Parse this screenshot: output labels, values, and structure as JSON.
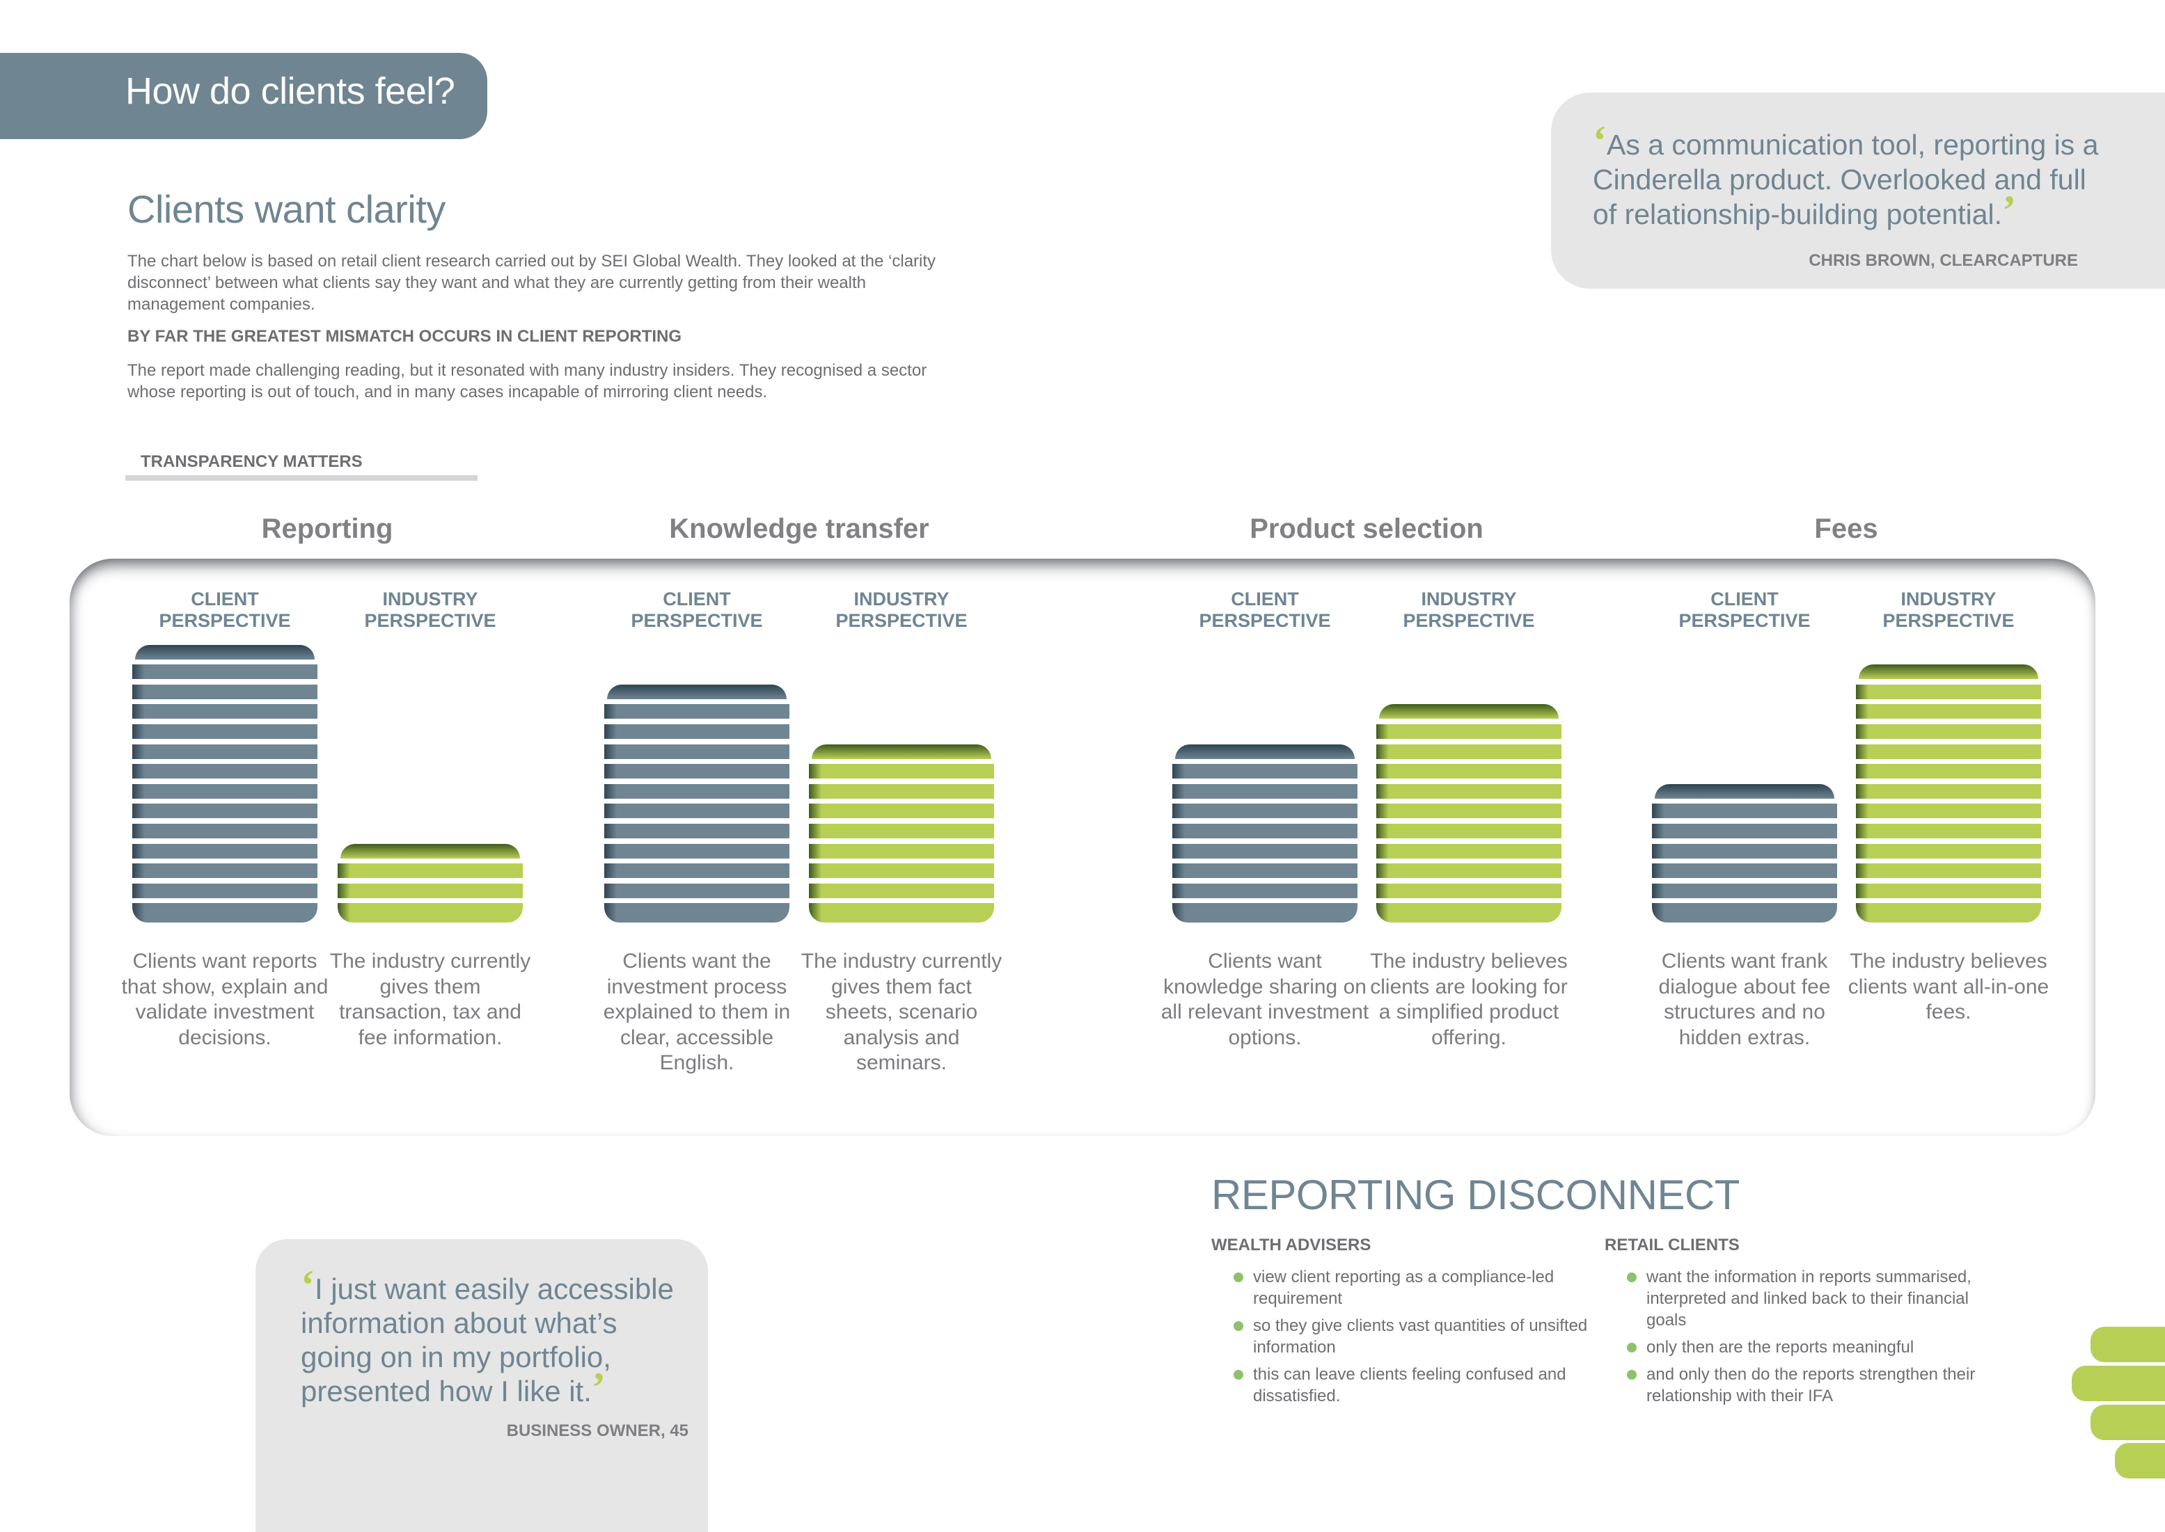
{
  "header": {
    "title": "How do clients feel?"
  },
  "intro": {
    "title": "Clients want clarity",
    "paragraph1": "The chart below is based on retail client research carried out by SEI Global Wealth. They looked at the ‘clarity disconnect’ between what clients say they want and what they are currently getting from their wealth management companies.",
    "heading": "BY FAR THE GREATEST MISMATCH OCCURS IN CLIENT REPORTING",
    "paragraph2": "The report made challenging reading, but it resonated with many industry insiders. They recognised a sector whose reporting is out of touch, and in many cases incapable of mirroring client needs."
  },
  "quote_top": {
    "open_mark": "‘",
    "text": "As a communication tool, reporting is a Cinderella product. Overlooked and full of relationship-building potential.",
    "close_mark": "’",
    "attribution": "CHRIS BROWN, CLEARCAPTURE"
  },
  "quote_bottom": {
    "open_mark": "‘",
    "text": "I just want easily accessible information about what’s going on in my portfolio, presented how I like it.",
    "close_mark": "’",
    "attribution": "BUSINESS OWNER, 45"
  },
  "transparency_label": "TRANSPARENCY MATTERS",
  "colors": {
    "slate": "#6f8592",
    "slate_dark": "#2f4452",
    "green": "#b7cf54",
    "green_dark": "#3f5a1e",
    "quote_bg": "#e6e6e7",
    "bullet": "#8dc26a"
  },
  "chart_data": {
    "type": "bar",
    "title": "TRANSPARENCY MATTERS",
    "unit": "stacked stripes (relative emphasis)",
    "categories": [
      "Reporting",
      "Knowledge transfer",
      "Product selection",
      "Fees"
    ],
    "series": [
      {
        "name": "CLIENT PERSPECTIVE",
        "label_line1": "CLIENT",
        "label_line2": "PERSPECTIVE",
        "color": "#6f8592",
        "values": [
          14,
          12,
          9,
          7
        ]
      },
      {
        "name": "INDUSTRY PERSPECTIVE",
        "label_line1": "INDUSTRY",
        "label_line2": "PERSPECTIVE",
        "color": "#b7cf54",
        "values": [
          4,
          9,
          11,
          13
        ]
      }
    ],
    "captions": [
      [
        "Clients want reports that show, explain and validate investment decisions.",
        "The industry currently gives them transaction, tax and fee information."
      ],
      [
        "Clients want the investment process explained to them in clear, accessible English.",
        "The industry currently gives them fact sheets, scenario analysis and seminars."
      ],
      [
        "Clients want knowledge sharing on all relevant investment options.",
        "The industry believes clients are looking for a simplified product offering."
      ],
      [
        "Clients want frank dialogue about fee structures and no hidden extras.",
        "The industry believes clients want all-in-one fees."
      ]
    ],
    "ylim": [
      0,
      14
    ],
    "grid": false,
    "xlabel": "",
    "ylabel": ""
  },
  "disconnect": {
    "title": "REPORTING DISCONNECT",
    "columns": [
      {
        "title": "WEALTH ADVISERS",
        "items": [
          "view client reporting as a compliance-led requirement",
          "so they give clients vast quantities of unsifted information",
          "this can leave clients feeling confused and dissatisfied."
        ]
      },
      {
        "title": "RETAIL CLIENTS",
        "items": [
          "want the information in reports summarised, interpreted and linked back to their financial goals",
          "only then are the reports meaningful",
          "and only then do the reports strengthen their relationship with their IFA"
        ]
      }
    ]
  }
}
